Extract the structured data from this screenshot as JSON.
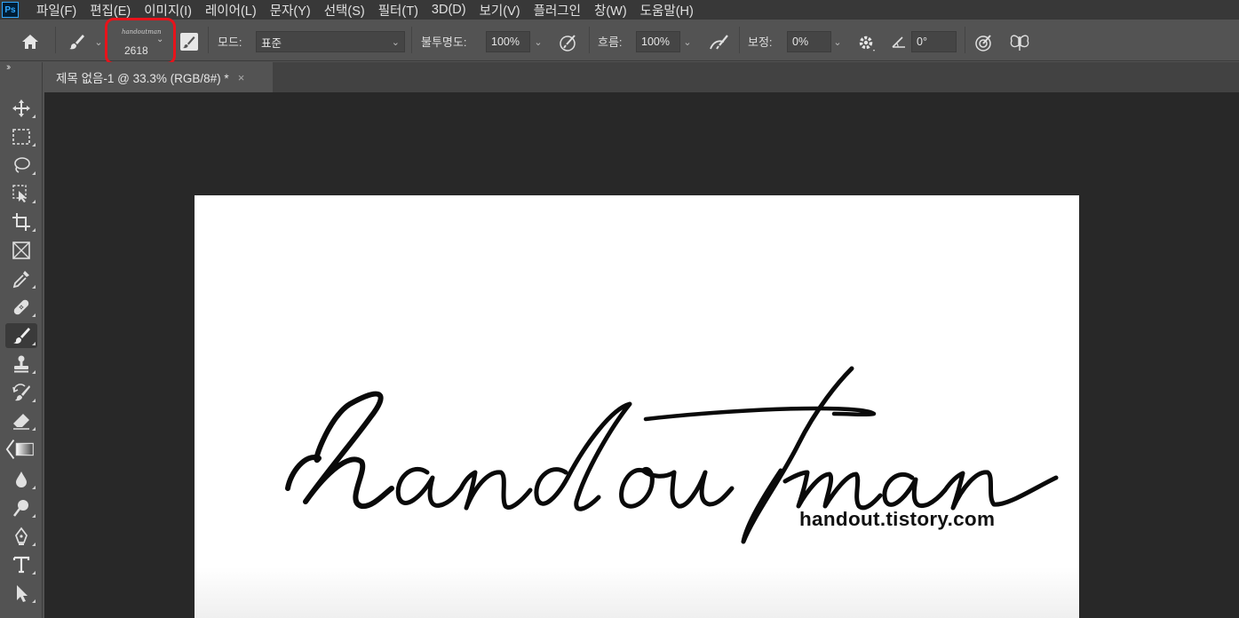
{
  "app": {
    "logo_text": "Ps"
  },
  "menu": [
    "파일(F)",
    "편집(E)",
    "이미지(I)",
    "레이어(L)",
    "문자(Y)",
    "선택(S)",
    "필터(T)",
    "3D(D)",
    "보기(V)",
    "플러그인",
    "창(W)",
    "도움말(H)"
  ],
  "options": {
    "brush_size": "2618",
    "brush_preview_text": "handoutman",
    "mode_label": "모드:",
    "mode_value": "표준",
    "opacity_label": "불투명도:",
    "opacity_value": "100%",
    "flow_label": "흐름:",
    "flow_value": "100%",
    "smoothing_label": "보정:",
    "smoothing_value": "0%",
    "angle_value": "0°"
  },
  "document_tab": {
    "title": "제목 없음-1 @ 33.3% (RGB/8#) *",
    "close": "×"
  },
  "canvas": {
    "signature_text": "handoutman",
    "url_text": "handout.tistory.com"
  },
  "toolbar": {
    "collapse": "››",
    "tools": [
      "move-tool",
      "marquee-tool",
      "lasso-tool",
      "object-selection-tool",
      "crop-tool",
      "frame-tool",
      "eyedropper-tool",
      "healing-brush-tool",
      "brush-tool",
      "stamp-tool",
      "history-brush-tool",
      "eraser-tool",
      "gradient-tool",
      "blur-tool",
      "dodge-tool",
      "pen-tool",
      "type-tool",
      "path-selection-tool"
    ],
    "active_tool": "brush-tool"
  },
  "colors": {
    "highlight": "#e8131b",
    "ps_blue": "#31a8ff"
  }
}
